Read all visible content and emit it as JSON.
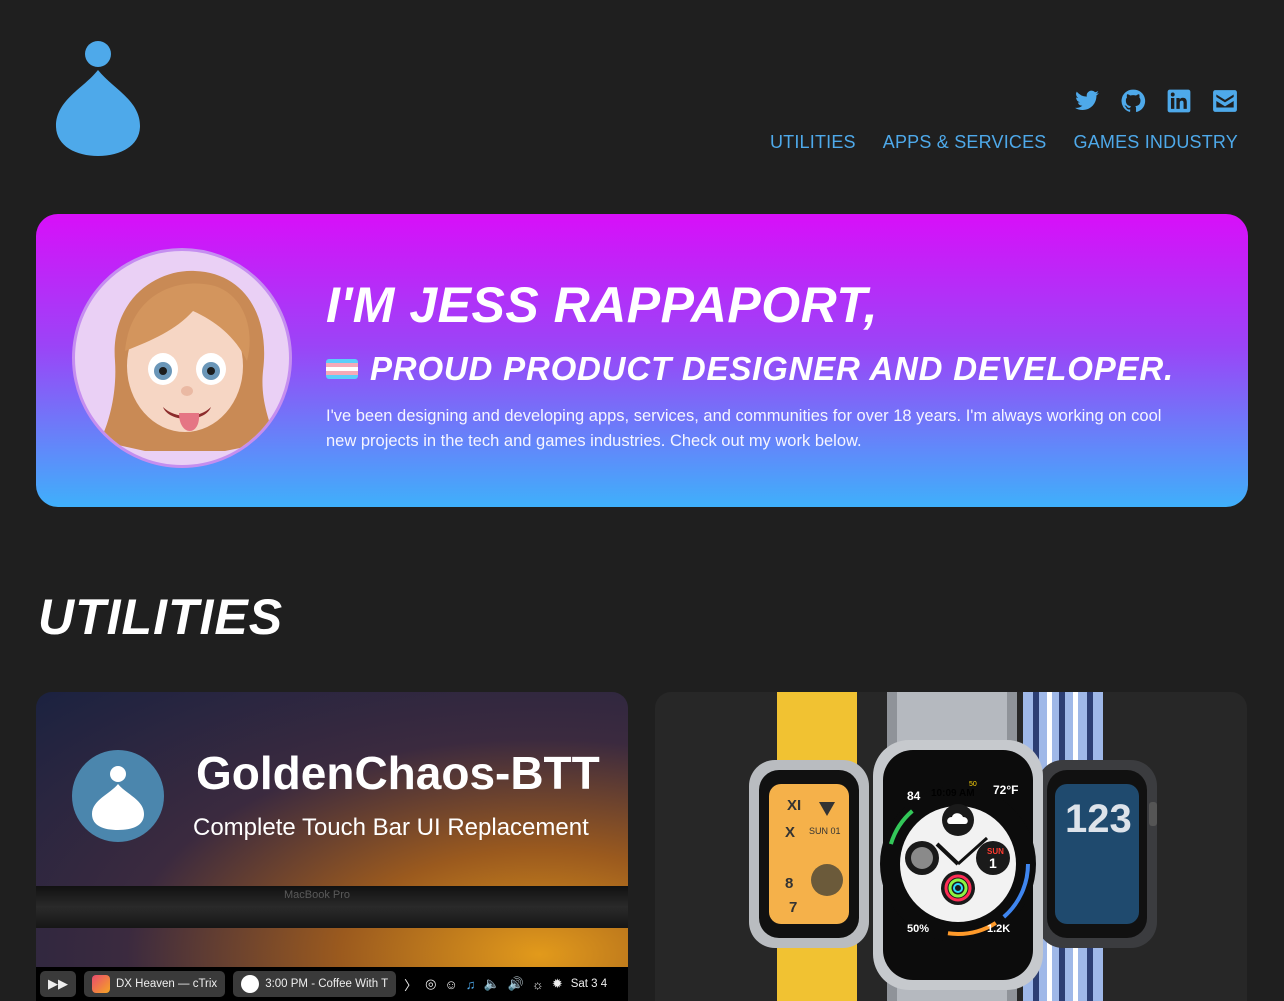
{
  "header": {
    "logo_name": "drop-logo",
    "social": [
      {
        "name": "twitter-icon"
      },
      {
        "name": "github-icon"
      },
      {
        "name": "linkedin-icon"
      },
      {
        "name": "email-icon"
      }
    ],
    "nav": [
      "UTILITIES",
      "APPS & SERVICES",
      "GAMES INDUSTRY"
    ]
  },
  "hero": {
    "title": "I'M JESS RAPPAPORT,",
    "subtitle": "PROUD PRODUCT DESIGNER AND DEVELOPER.",
    "intro": "I've been designing and developing apps, services, and communities for over 18 years. I'm always working on cool new projects in the tech and games industries. Check out my work below."
  },
  "section": {
    "title": "UTILITIES"
  },
  "cards": {
    "goldenchaos": {
      "title": "GoldenChaos-BTT",
      "subtitle": "Complete Touch Bar UI Replacement",
      "macbook_label": "MacBook Pro",
      "touchbar": {
        "now_playing": "DX Heaven — cTrix",
        "calendar": "3:00 PM - Coffee With T",
        "date": "Sat 3 4"
      }
    },
    "watch": {
      "complication_top_left": "84",
      "complication_time": "10:09 AM",
      "complication_temp": "72°F",
      "complication_50": "50",
      "complication_day": "SUN",
      "complication_date": "1",
      "complication_humidity": "50%",
      "complication_steps": "1.2K",
      "left_face_xi": "XI",
      "left_face_x": "X",
      "left_face_8": "8",
      "left_face_7": "7",
      "left_face_day": "SUN 01",
      "right_face_digits": "123"
    }
  },
  "colors": {
    "accent": "#4ea9ea",
    "background": "#1f1f1f",
    "hero_top": "#d80ff9",
    "hero_bottom": "#3fb0fb"
  }
}
